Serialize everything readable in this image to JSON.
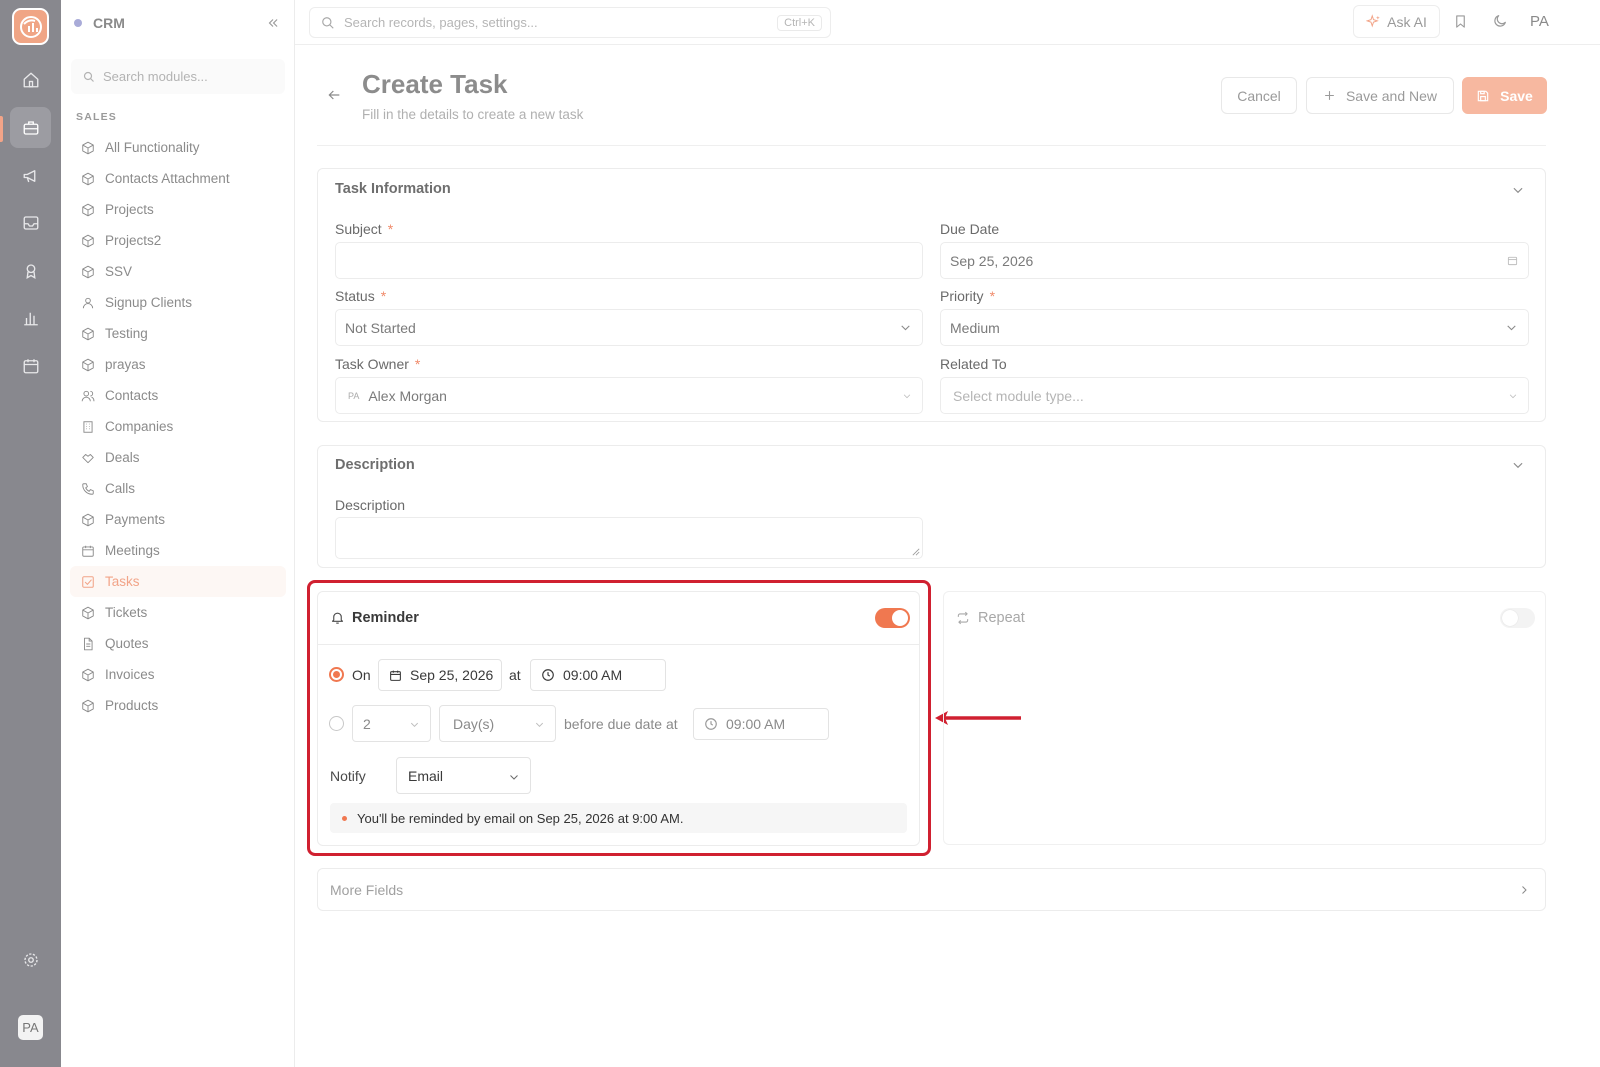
{
  "brand": {
    "accent": "#F07850",
    "highlight": "#D02030"
  },
  "sidebar": {
    "title": "CRM",
    "search_placeholder": "Search modules...",
    "section": "SALES",
    "items": [
      {
        "label": "All Functionality",
        "icon": "cube-icon"
      },
      {
        "label": "Contacts Attachment",
        "icon": "cube-icon"
      },
      {
        "label": "Projects",
        "icon": "cube-icon"
      },
      {
        "label": "Projects2",
        "icon": "cube-icon"
      },
      {
        "label": "SSV",
        "icon": "cube-icon"
      },
      {
        "label": "Signup Clients",
        "icon": "user-icon"
      },
      {
        "label": "Testing",
        "icon": "cube-icon"
      },
      {
        "label": "prayas",
        "icon": "cube-icon"
      },
      {
        "label": "Contacts",
        "icon": "users-icon"
      },
      {
        "label": "Companies",
        "icon": "building-icon"
      },
      {
        "label": "Deals",
        "icon": "handshake-icon"
      },
      {
        "label": "Calls",
        "icon": "phone-icon"
      },
      {
        "label": "Payments",
        "icon": "cube-icon"
      },
      {
        "label": "Meetings",
        "icon": "calendar-icon"
      },
      {
        "label": "Tasks",
        "icon": "checkbox-icon",
        "active": true
      },
      {
        "label": "Tickets",
        "icon": "cube-icon"
      },
      {
        "label": "Quotes",
        "icon": "document-icon"
      },
      {
        "label": "Invoices",
        "icon": "cube-icon"
      },
      {
        "label": "Products",
        "icon": "cube-icon"
      }
    ]
  },
  "rail": {
    "avatar": "PA"
  },
  "topbar": {
    "search_placeholder": "Search records, pages, settings...",
    "shortcut": "Ctrl+K",
    "ask_ai": "Ask AI",
    "user_initials": "PA"
  },
  "page": {
    "title": "Create Task",
    "subtitle": "Fill in the details to create a new task",
    "cancel": "Cancel",
    "save_and_new": "Save and New",
    "save": "Save"
  },
  "task_info": {
    "title": "Task Information",
    "subject_label": "Subject",
    "subject_value": "",
    "due_date_label": "Due Date",
    "due_date_value": "Sep 25, 2026",
    "status_label": "Status",
    "status_value": "Not Started",
    "priority_label": "Priority",
    "priority_value": "Medium",
    "owner_label": "Task Owner",
    "owner_initials": "PA",
    "owner_value": "Alex Morgan",
    "related_label": "Related To",
    "related_placeholder": "Select module type...",
    "required_mark": "*"
  },
  "description": {
    "title": "Description",
    "label": "Description",
    "value": ""
  },
  "reminder": {
    "title": "Reminder",
    "enabled": true,
    "on_label": "On",
    "on_date": "Sep 25, 2026",
    "at_label": "at",
    "on_time": "09:00 AM",
    "before_amount": "2",
    "before_unit": "Day(s)",
    "before_text": "before due date at",
    "before_time": "09:00 AM",
    "notify_label": "Notify",
    "notify_value": "Email",
    "summary": "You'll be reminded by email on Sep 25, 2026 at 9:00 AM."
  },
  "repeat": {
    "title": "Repeat",
    "enabled": false
  },
  "more_fields": {
    "label": "More Fields"
  }
}
